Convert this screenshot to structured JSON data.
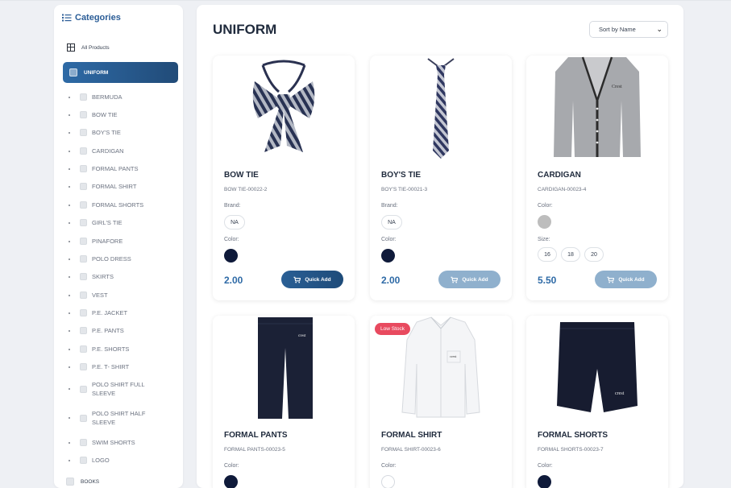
{
  "sidebar": {
    "title": "Categories",
    "all_products": "All Products",
    "active": "UNIFORM",
    "items": [
      "BERMUDA",
      "BOW TIE",
      "BOY'S TIE",
      "CARDIGAN",
      "FORMAL PANTS",
      "FORMAL SHIRT",
      "FORMAL SHORTS",
      "GIRL'S TIE",
      "PINAFORE",
      "POLO DRESS",
      "SKIRTS",
      "VEST",
      "P.E. JACKET",
      "P.E. PANTS",
      "P.E. SHORTS",
      "P.E. T- SHIRT",
      "POLO SHIRT FULL SLEEVE",
      "POLO SHIRT HALF SLEEVE",
      "SWIM SHORTS",
      "LOGO"
    ],
    "books": "BOOKS"
  },
  "main": {
    "title": "UNIFORM",
    "sort_label": "Sort by Name",
    "products": [
      {
        "name": "BOW TIE",
        "code": "BOW TIE-00022-2",
        "brand_label": "Brand:",
        "brand": "NA",
        "color_label": "Color:",
        "colors": [
          "#0f1a3a"
        ],
        "price": "2.00",
        "button": "Quick Add"
      },
      {
        "name": "BOY'S TIE",
        "code": "BOY'S TIE-00021-3",
        "brand_label": "Brand:",
        "brand": "NA",
        "color_label": "Color:",
        "colors": [
          "#0f1a3a"
        ],
        "price": "2.00",
        "button": "Quick Add"
      },
      {
        "name": "CARDIGAN",
        "code": "CARDIGAN-00023-4",
        "color_label": "Color:",
        "colors": [
          "#bdbdbd"
        ],
        "size_label": "Size:",
        "sizes": [
          "16",
          "18",
          "20"
        ],
        "price": "5.50",
        "button": "Quick Add"
      },
      {
        "name": "FORMAL PANTS",
        "code": "FORMAL PANTS-00023-5",
        "color_label": "Color:",
        "colors": [
          "#0f1a3a"
        ]
      },
      {
        "name": "FORMAL SHIRT",
        "code": "FORMAL SHIRT-00023-6",
        "badge": "Low Stock",
        "color_label": "Color:",
        "colors": [
          "#ffffff"
        ]
      },
      {
        "name": "FORMAL SHORTS",
        "code": "FORMAL SHORTS-00023-7",
        "color_label": "Color:",
        "colors": [
          "#0f1a3a"
        ]
      }
    ]
  },
  "colors": {
    "accent": "#2e6aa6",
    "badge": "#e84a5f",
    "navy": "#0f1a3a"
  }
}
